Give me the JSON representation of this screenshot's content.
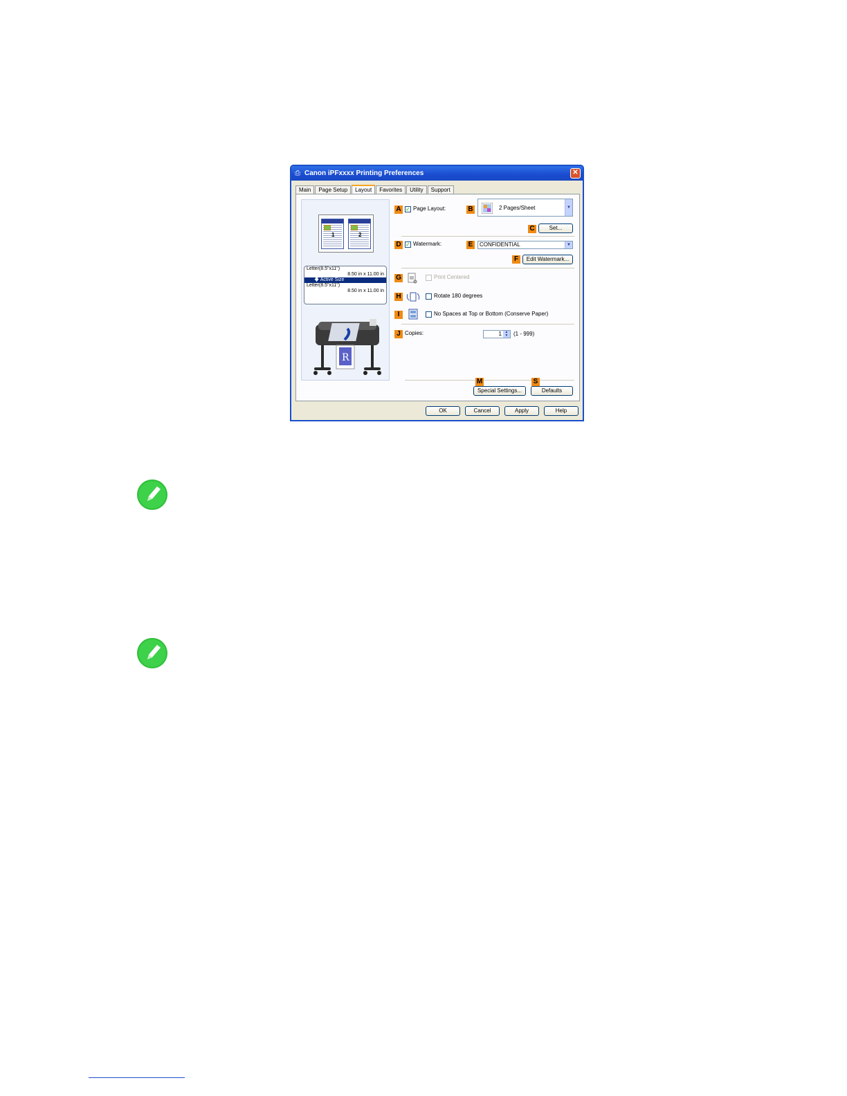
{
  "window": {
    "title": "Canon iPFxxxx Printing Preferences",
    "close_label": "✕"
  },
  "tabs": [
    {
      "label": "Main"
    },
    {
      "label": "Page Setup"
    },
    {
      "label": "Layout",
      "active": true
    },
    {
      "label": "Favorites"
    },
    {
      "label": "Utility"
    },
    {
      "label": "Support"
    }
  ],
  "preview": {
    "page_numbers": [
      "1",
      "2"
    ],
    "size_box": {
      "original": "Letter(8.5\"x11\")",
      "original_dims": "8.50 in x 11.00 in",
      "active_label": "Active Size",
      "output": "Letter(8.5\"x11\")",
      "output_dims": "8.50 in x 11.00 in"
    }
  },
  "layout": {
    "page_layout": {
      "badge": "A",
      "label": "Page Layout:",
      "checked": true
    },
    "pages_select": {
      "badge": "B",
      "value": "2 Pages/Sheet"
    },
    "set_button": {
      "badge": "C",
      "label": "Set..."
    },
    "watermark": {
      "badge": "D",
      "label": "Watermark:",
      "checked": true
    },
    "watermark_select": {
      "badge": "E",
      "value": "CONFIDENTIAL"
    },
    "edit_watermark": {
      "badge": "F",
      "label": "Edit Watermark..."
    },
    "print_centered": {
      "badge": "G",
      "label": "Print Centered",
      "checked": false,
      "disabled": true
    },
    "rotate": {
      "badge": "H",
      "label": "Rotate 180 degrees",
      "checked": false
    },
    "no_spaces": {
      "badge": "I",
      "label": "No Spaces at Top or Bottom (Conserve Paper)",
      "checked": false
    },
    "copies": {
      "badge": "J",
      "label": "Copies:",
      "value": "1",
      "range": "(1 - 999)"
    },
    "special_settings": {
      "badge": "M",
      "label": "Special Settings..."
    },
    "defaults": {
      "badge": "S",
      "label": "Defaults"
    }
  },
  "footer_buttons": {
    "ok": "OK",
    "cancel": "Cancel",
    "apply": "Apply",
    "help": "Help"
  },
  "colors": {
    "title_bar": "#1a4cd0",
    "badge": "#ef8a14",
    "note_icon": "#2fbf3a"
  }
}
